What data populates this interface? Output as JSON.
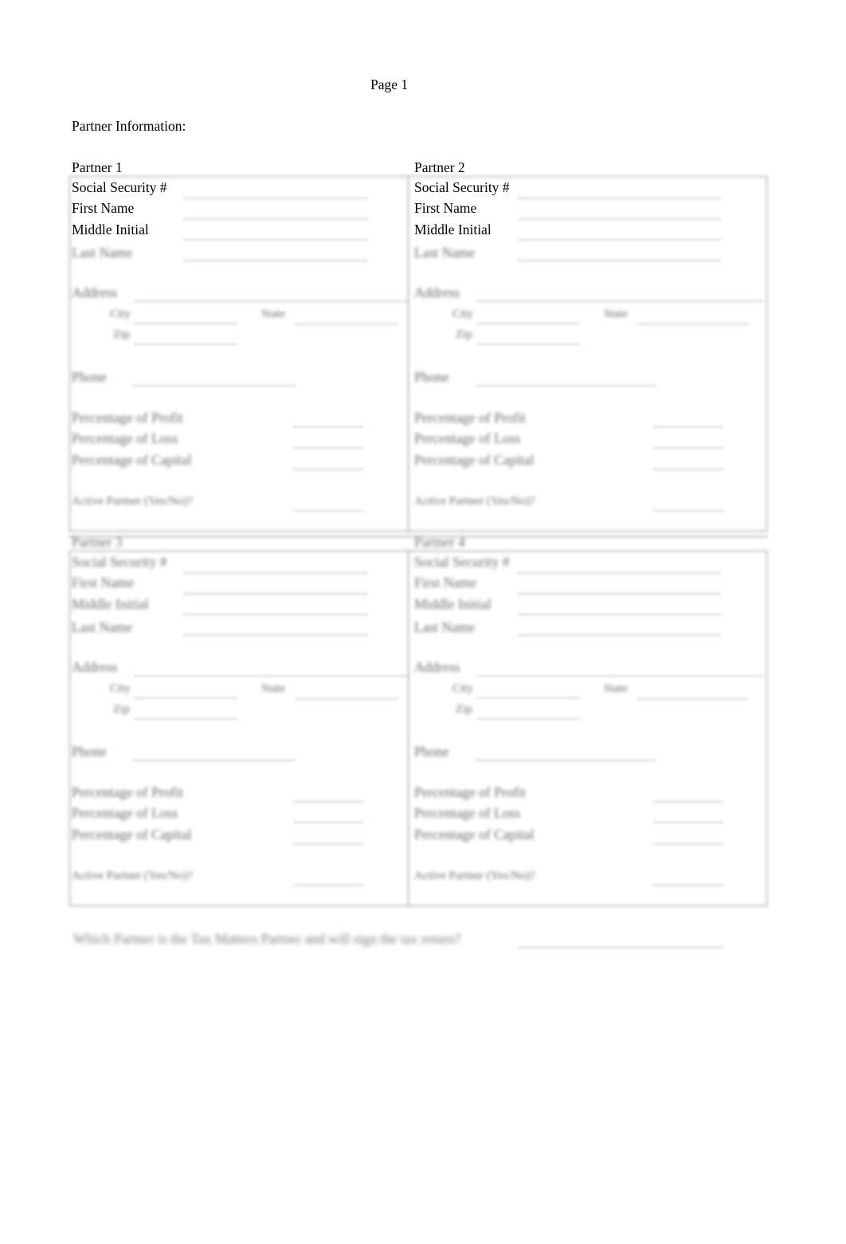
{
  "page_label": "Page 1",
  "section_title": "Partner Information:",
  "partners": [
    {
      "heading": "Partner 1",
      "ssn_label": "Social Security #",
      "first_name_label": "First Name",
      "middle_initial_label": "Middle Initial",
      "last_name_label": "Last Name",
      "address_label": "Address",
      "city_label": "City",
      "zip_label": "Zip",
      "state_label": "State",
      "phone_label": "Phone",
      "pct_profit_label": "Percentage of Profit",
      "pct_loss_label": "Percentage of Loss",
      "pct_capital_label": "Percentage of Capital",
      "active_label": "Active Partner (Yes/No)?"
    },
    {
      "heading": "Partner 2",
      "ssn_label": "Social Security #",
      "first_name_label": "First Name",
      "middle_initial_label": "Middle Initial",
      "last_name_label": "Last Name",
      "address_label": "Address",
      "city_label": "City",
      "zip_label": "Zip",
      "state_label": "State",
      "phone_label": "Phone",
      "pct_profit_label": "Percentage of Profit",
      "pct_loss_label": "Percentage of Loss",
      "pct_capital_label": "Percentage of Capital",
      "active_label": "Active Partner (Yes/No)?"
    },
    {
      "heading": "Partner 3",
      "ssn_label": "Social Security #",
      "first_name_label": "First Name",
      "middle_initial_label": "Middle Initial",
      "last_name_label": "Last Name",
      "address_label": "Address",
      "city_label": "City",
      "zip_label": "Zip",
      "state_label": "State",
      "phone_label": "Phone",
      "pct_profit_label": "Percentage of Profit",
      "pct_loss_label": "Percentage of Loss",
      "pct_capital_label": "Percentage of Capital",
      "active_label": "Active Partner (Yes/No)?"
    },
    {
      "heading": "Partner 4",
      "ssn_label": "Social Security #",
      "first_name_label": "First Name",
      "middle_initial_label": "Middle Initial",
      "last_name_label": "Last Name",
      "address_label": "Address",
      "city_label": "City",
      "zip_label": "Zip",
      "state_label": "State",
      "phone_label": "Phone",
      "pct_profit_label": "Percentage of Profit",
      "pct_loss_label": "Percentage of Loss",
      "pct_capital_label": "Percentage of Capital",
      "active_label": "Active Partner (Yes/No)?"
    }
  ],
  "footer_question": "Which Partner is the Tax Matters Partner and will sign the tax return?"
}
